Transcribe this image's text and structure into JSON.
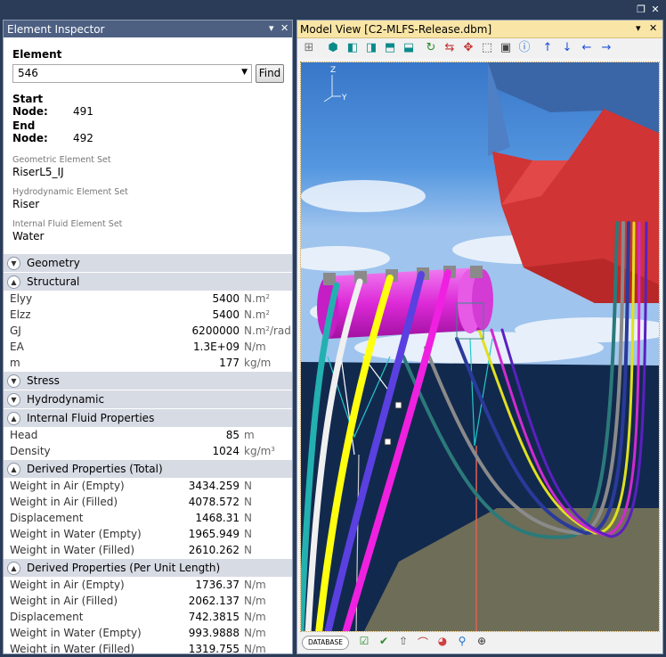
{
  "inspector": {
    "title": "Element Inspector",
    "element_label": "Element",
    "element_value": "546",
    "find_label": "Find",
    "start_node_label": "Start Node:",
    "start_node_value": "491",
    "end_node_label": "End Node:",
    "end_node_value": "492",
    "geo_set_label": "Geometric Element Set",
    "geo_set_value": "RiserL5_IJ",
    "hydro_set_label": "Hydrodynamic Element Set",
    "hydro_set_value": "Riser",
    "fluid_set_label": "Internal Fluid Element Set",
    "fluid_set_value": "Water",
    "sections": {
      "geometry": "Geometry",
      "structural": "Structural",
      "stress": "Stress",
      "hydrodynamic": "Hydrodynamic",
      "internal_fluid": "Internal Fluid Properties",
      "derived_total": "Derived Properties (Total)",
      "derived_per_length": "Derived Properties (Per Unit Length)"
    },
    "structural": [
      {
        "name": "Elyy",
        "value": "5400",
        "unit": "N.m",
        "sup": "2"
      },
      {
        "name": "Elzz",
        "value": "5400",
        "unit": "N.m",
        "sup": "2"
      },
      {
        "name": "GJ",
        "value": "6200000",
        "unit": "N.m",
        "sup": "2",
        "unit2": "/rad"
      },
      {
        "name": "EA",
        "value": "1.3E+09",
        "unit": "N/m"
      },
      {
        "name": "m",
        "value": "177",
        "unit": "kg/m"
      }
    ],
    "internal_fluid": [
      {
        "name": "Head",
        "value": "85",
        "unit": "m"
      },
      {
        "name": "Density",
        "value": "1024",
        "unit": "kg/m",
        "sup": "3"
      }
    ],
    "derived_total": [
      {
        "name": "Weight in Air (Empty)",
        "value": "3434.259",
        "unit": "N"
      },
      {
        "name": "Weight in Air (Filled)",
        "value": "4078.572",
        "unit": "N"
      },
      {
        "name": "Displacement",
        "value": "1468.31",
        "unit": "N"
      },
      {
        "name": "Weight in Water (Empty)",
        "value": "1965.949",
        "unit": "N"
      },
      {
        "name": "Weight in Water (Filled)",
        "value": "2610.262",
        "unit": "N"
      }
    ],
    "derived_per_length": [
      {
        "name": "Weight in Air (Empty)",
        "value": "1736.37",
        "unit": "N/m"
      },
      {
        "name": "Weight in Air (Filled)",
        "value": "2062.137",
        "unit": "N/m"
      },
      {
        "name": "Displacement",
        "value": "742.3815",
        "unit": "N/m"
      },
      {
        "name": "Weight in Water (Empty)",
        "value": "993.9888",
        "unit": "N/m"
      },
      {
        "name": "Weight in Water (Filled)",
        "value": "1319.755",
        "unit": "N/m"
      }
    ]
  },
  "model_view": {
    "title": "Model View [C2-MLFS-Release.dbm]",
    "database_label": "DATABASE",
    "axis_labels": {
      "z": "Z",
      "y": "Y"
    },
    "toolbar_icons": [
      "grid-icon",
      "view-iso-icon",
      "view-front-icon",
      "view-side-icon",
      "view-top-icon",
      "view-back-icon",
      "rotate-icon",
      "pan-icon",
      "move-icon",
      "zoom-box-icon",
      "camera-icon",
      "info-icon",
      "arrow-up-icon",
      "arrow-down-icon",
      "arrow-left-icon",
      "arrow-right-icon"
    ],
    "colors": {
      "accent": "#4d6082",
      "title_active": "#f9e5a6",
      "sea": "#12294e",
      "sky": "#3e7fd0",
      "seabed": "#6e6d58",
      "vessel": "#d03434",
      "buoy": "#de2bd9"
    }
  }
}
